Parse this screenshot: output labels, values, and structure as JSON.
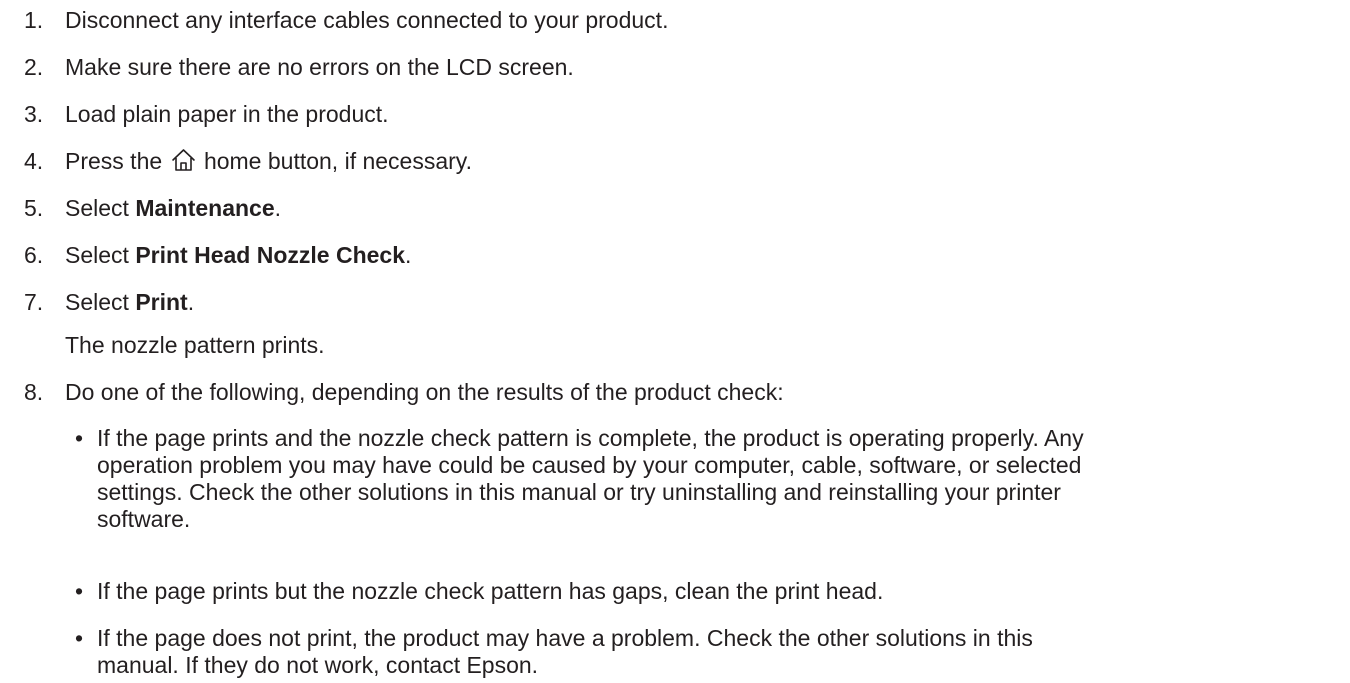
{
  "steps": [
    {
      "num": "1.",
      "text": "Disconnect any interface cables connected to your product."
    },
    {
      "num": "2.",
      "text": "Make sure there are no errors on the LCD screen."
    },
    {
      "num": "3.",
      "text": "Load plain paper in the product."
    },
    {
      "num": "4.",
      "pre": "Press the",
      "icon": "home-icon",
      "post": "home button, if necessary."
    },
    {
      "num": "5.",
      "pre": "Select ",
      "bold": "Maintenance",
      "post": "."
    },
    {
      "num": "6.",
      "pre": "Select ",
      "bold": "Print Head Nozzle Check",
      "post": "."
    },
    {
      "num": "7.",
      "pre": "Select ",
      "bold": "Print",
      "post": ".",
      "sub": "The nozzle pattern prints."
    },
    {
      "num": "8.",
      "text": "Do one of the following, depending on the results of the product check:"
    }
  ],
  "bullets": [
    {
      "dot": "•",
      "lines": [
        "If the page prints and the nozzle check pattern is complete, the product is operating properly. Any",
        "operation problem you may have could be caused by your computer, cable, software, or selected",
        "settings. Check the other solutions in this manual or try uninstalling and reinstalling your printer",
        "software."
      ]
    },
    {
      "dot": "•",
      "lines": [
        "If the page prints but the nozzle check pattern has gaps, clean the print head."
      ]
    },
    {
      "dot": "•",
      "lines": [
        "If the page does not print, the product may have a problem. Check the other solutions in this",
        "manual. If they do not work, contact Epson."
      ]
    }
  ]
}
